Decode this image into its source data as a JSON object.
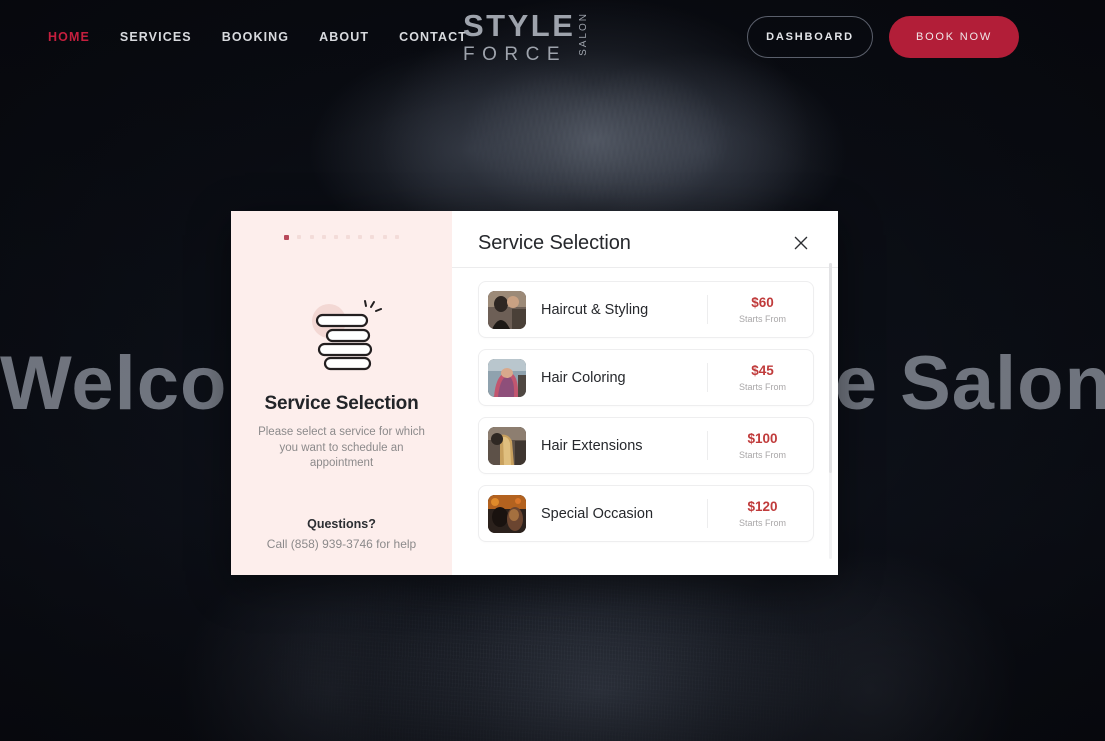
{
  "nav": {
    "links": [
      {
        "label": "HOME",
        "active": true
      },
      {
        "label": "SERVICES",
        "active": false
      },
      {
        "label": "BOOKING",
        "active": false
      },
      {
        "label": "ABOUT",
        "active": false
      },
      {
        "label": "CONTACT",
        "active": false
      }
    ],
    "logo": {
      "line1": "STYLE",
      "line2": "FORCE",
      "vertical": "SALON"
    },
    "dashboard_label": "DASHBOARD",
    "book_now_label": "BOOK NOW"
  },
  "hero": {
    "heading": "Welcome to Style Force Salon"
  },
  "modal": {
    "title": "Service Selection",
    "close_icon": "close-icon",
    "aside": {
      "icon": "service-stack-icon",
      "title": "Service Selection",
      "description": "Please select a service for which you want to schedule an appointment",
      "questions_label": "Questions?",
      "call_text": "Call (858) 939-3746 for help",
      "steps_total": 10,
      "step_active_index": 0
    },
    "price_caption": "Starts From",
    "services": [
      {
        "name": "Haircut & Styling",
        "price": "$60",
        "caption": "Starts From",
        "thumb": "haircut-styling-thumb"
      },
      {
        "name": "Hair Coloring",
        "price": "$45",
        "caption": "Starts From",
        "thumb": "hair-coloring-thumb"
      },
      {
        "name": "Hair Extensions",
        "price": "$100",
        "caption": "Starts From",
        "thumb": "hair-extensions-thumb"
      },
      {
        "name": "Special Occasion",
        "price": "$120",
        "caption": "Starts From",
        "thumb": "special-occasion-thumb"
      }
    ]
  },
  "colors": {
    "accent_red": "#c41f3e",
    "button_red": "#b21e38",
    "price_red": "#c03b3b",
    "aside_pink": "#fdeeec",
    "page_dark": "#0a0c12"
  }
}
